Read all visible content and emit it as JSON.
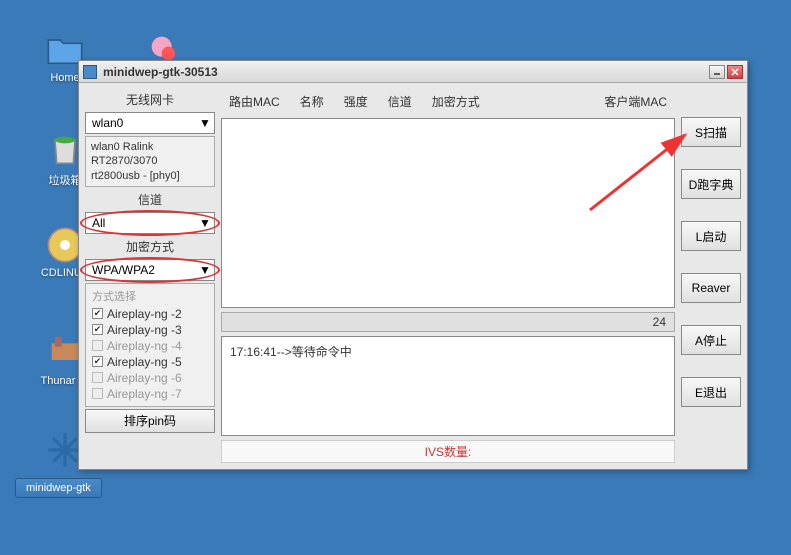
{
  "desktop": {
    "icons": [
      {
        "label": "Home"
      },
      {
        "label": ""
      },
      {
        "label": "垃圾箱"
      },
      {
        "label": "CDLINUX"
      },
      {
        "label": "Thunar 文"
      }
    ]
  },
  "taskbar": {
    "app": "minidwep-gtk"
  },
  "window": {
    "title": "minidwep-gtk-30513"
  },
  "left": {
    "wireless_label": "无线网卡",
    "wireless_value": "wlan0",
    "adapter_info": "wlan0 Ralink RT2870/3070 rt2800usb - [phy0]",
    "channel_label": "信道",
    "channel_value": "All",
    "encrypt_label": "加密方式",
    "encrypt_value": "WPA/WPA2",
    "method_title": "方式选择",
    "methods": [
      {
        "label": "Aireplay-ng -2",
        "checked": true,
        "enabled": true
      },
      {
        "label": "Aireplay-ng -3",
        "checked": true,
        "enabled": true
      },
      {
        "label": "Aireplay-ng -4",
        "checked": false,
        "enabled": false
      },
      {
        "label": "Aireplay-ng -5",
        "checked": true,
        "enabled": true
      },
      {
        "label": "Aireplay-ng -6",
        "checked": false,
        "enabled": false
      },
      {
        "label": "Aireplay-ng -7",
        "checked": false,
        "enabled": false
      }
    ],
    "pin_button": "排序pin码"
  },
  "headers": {
    "mac": "路由MAC",
    "name": "名称",
    "signal": "强度",
    "channel": "信道",
    "encrypt": "加密方式",
    "client": "客户端MAC"
  },
  "count": "24",
  "log": "17:16:41-->等待命令中",
  "ivs": "IVS数量:",
  "buttons": {
    "scan": "S扫描",
    "dict": "D跑字典",
    "launch": "L启动",
    "reaver": "Reaver",
    "stop": "A停止",
    "exit": "E退出"
  }
}
